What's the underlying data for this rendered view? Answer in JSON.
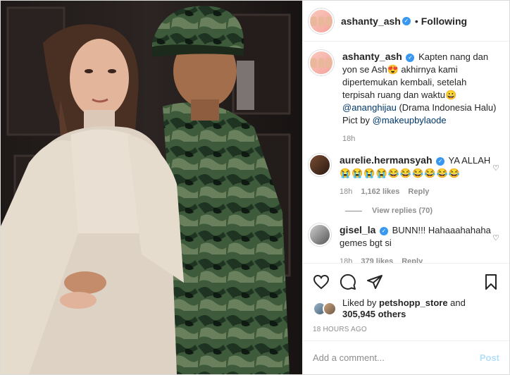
{
  "post": {
    "username": "ashanty_ash",
    "follow_status": "Following",
    "caption": {
      "username": "ashanty_ash",
      "text_1": "Kapten nang dan yon se Ash",
      "emoji_1": "😍",
      "text_2": " akhirnya kami dipertemukan kembali, setelah terpisah ruang dan waktu",
      "emoji_2": "😀",
      "mention_1": "@ananghijau",
      "text_3": " (Drama Indonesia Halu) Pict by ",
      "mention_2": "@makeupbylaode",
      "age": "18h"
    },
    "comments": [
      {
        "username": "aurelie.hermansyah",
        "text": "YA ALLAH",
        "emojis": "😭😭😭😭😂😂😂😂😂😂",
        "age": "18h",
        "likes": "1,162 likes",
        "reply": "Reply",
        "view_replies": "View replies (70)"
      },
      {
        "username": "gisel_la",
        "text": "BUNN!!! Hahaaahahaha gemes bgt si",
        "age": "18h",
        "likes": "379 likes",
        "reply": "Reply"
      }
    ],
    "liked_by_prefix": "Liked by ",
    "liked_by_user": "petshopp_store",
    "liked_by_and": " and",
    "likes_count": "305,945 others",
    "timestamp": "18 HOURS AGO",
    "add_comment_placeholder": "Add a comment...",
    "post_button": "Post",
    "icons": {
      "like": "heart-icon",
      "comment": "comment-icon",
      "share": "share-icon",
      "save": "bookmark-icon",
      "verified": "verified-badge-icon"
    },
    "colors": {
      "link": "#00376b",
      "verified": "#3897f0",
      "muted": "#8e8e8e",
      "post_button_disabled": "#b2dffc"
    }
  }
}
